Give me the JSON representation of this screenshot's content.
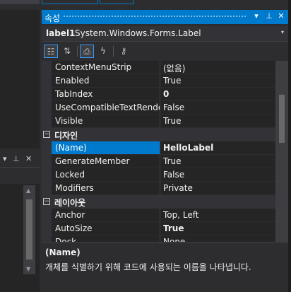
{
  "left_panel": {
    "pin_icon": "▾",
    "pin_glyph": "⊥",
    "close_glyph": "✕"
  },
  "properties": {
    "title": "속성",
    "title_buttons": {
      "dropdown": "▾",
      "pin": "⊥",
      "close": "✕"
    },
    "object_name": "label1",
    "object_type": "System.Windows.Forms.Label",
    "object_dropdown": "▾",
    "toolbar": [
      {
        "icon": "categorized-icon",
        "glyph": "☷",
        "active": true
      },
      {
        "icon": "alphabetical-icon",
        "glyph": "⇅",
        "active": false
      },
      {
        "icon": "properties-icon",
        "glyph": "⎙",
        "active": true
      },
      {
        "icon": "events-icon",
        "glyph": "ϟ",
        "active": false
      },
      {
        "icon": "property-pages-icon",
        "glyph": "⚷",
        "active": false
      }
    ],
    "rows": [
      {
        "kind": "prop",
        "name": "ContextMenuStrip",
        "value": "(없음)",
        "bold": false
      },
      {
        "kind": "prop",
        "name": "Enabled",
        "value": "True",
        "bold": false
      },
      {
        "kind": "prop",
        "name": "TabIndex",
        "value": "0",
        "bold": true
      },
      {
        "kind": "prop",
        "name": "UseCompatibleTextRendering",
        "value": "False",
        "bold": false
      },
      {
        "kind": "prop",
        "name": "Visible",
        "value": "True",
        "bold": false
      },
      {
        "kind": "cat",
        "name": "디자인",
        "toggle": "−"
      },
      {
        "kind": "prop",
        "name": "(Name)",
        "value": "HelloLabel",
        "bold": true,
        "selected": true
      },
      {
        "kind": "prop",
        "name": "GenerateMember",
        "value": "True",
        "bold": false
      },
      {
        "kind": "prop",
        "name": "Locked",
        "value": "False",
        "bold": false
      },
      {
        "kind": "prop",
        "name": "Modifiers",
        "value": "Private",
        "bold": false
      },
      {
        "kind": "cat",
        "name": "레이아웃",
        "toggle": "−"
      },
      {
        "kind": "prop",
        "name": "Anchor",
        "value": "Top, Left",
        "bold": false
      },
      {
        "kind": "prop",
        "name": "AutoSize",
        "value": "True",
        "bold": true
      },
      {
        "kind": "prop",
        "name": "Dock",
        "value": "None",
        "bold": false
      }
    ],
    "description_title": "(Name)",
    "description_text": "개체를 식별하기 위해 코드에 사용되는 이름을 나타냅니다."
  },
  "colors": {
    "accent": "#007acc",
    "background": "#2d2d30",
    "grid": "#252526"
  }
}
